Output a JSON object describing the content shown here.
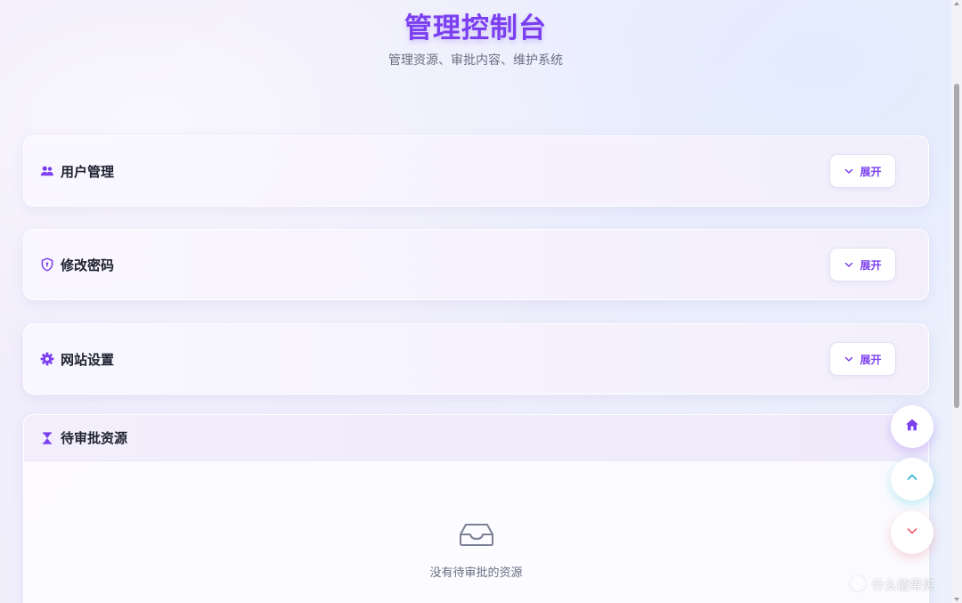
{
  "header": {
    "title": "管理控制台",
    "subtitle": "管理资源、审批内容、维护系统"
  },
  "panels": [
    {
      "title": "用户管理",
      "icon": "users-icon",
      "button_label": "展开"
    },
    {
      "title": "修改密码",
      "icon": "shield-icon",
      "button_label": "展开"
    },
    {
      "title": "网站设置",
      "icon": "gear-icon",
      "button_label": "展开"
    }
  ],
  "pending": {
    "title": "待审批资源",
    "icon": "hourglass-icon",
    "empty_text": "没有待审批的资源",
    "empty_icon": "inbox-icon"
  },
  "fabs": [
    {
      "name": "home",
      "icon": "home-icon"
    },
    {
      "name": "scroll-up",
      "icon": "chevron-up-icon"
    },
    {
      "name": "scroll-down",
      "icon": "chevron-down-icon"
    }
  ],
  "watermark": {
    "text": "什么值得买"
  },
  "colors": {
    "accent": "#7b3ff0",
    "title_text": "#1e2130",
    "muted_text": "#6b6f82",
    "up_accent": "#2bb8c9",
    "down_accent": "#f06478"
  }
}
